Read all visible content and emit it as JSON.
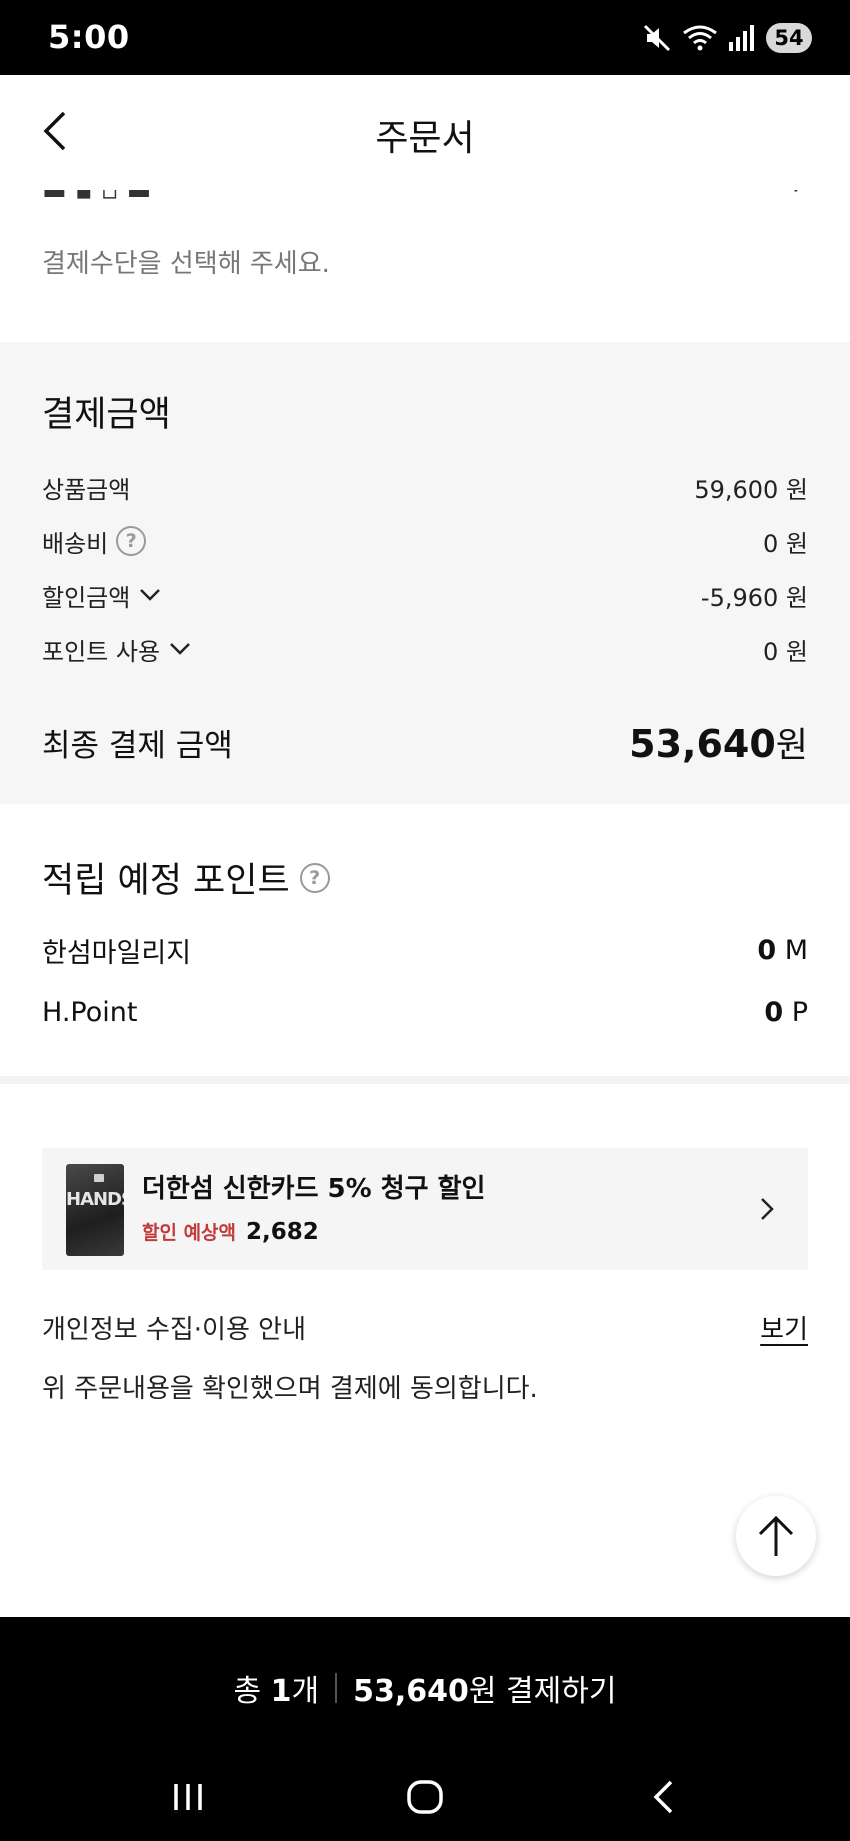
{
  "status_bar": {
    "time": "5:00",
    "battery": "54"
  },
  "header": {
    "title": "주문서"
  },
  "payment_method": {
    "hint": "결제수단을 선택해 주세요."
  },
  "payment_amount": {
    "title": "결제금액",
    "rows": [
      {
        "label": "상품금액",
        "value": "59,600 원"
      },
      {
        "label": "배송비",
        "value": "0 원"
      },
      {
        "label": "할인금액",
        "value": "-5,960 원"
      },
      {
        "label": "포인트 사용",
        "value": "0 원"
      }
    ],
    "final_label": "최종 결제 금액",
    "final_value": "53,640",
    "final_unit": "원"
  },
  "points": {
    "title": "적립 예정 포인트",
    "rows": [
      {
        "label": "한섬마일리지",
        "value": "0",
        "unit": "M"
      },
      {
        "label": "H.Point",
        "value": "0",
        "unit": "P"
      }
    ]
  },
  "card_banner": {
    "title": "더한섬 신한카드 5% 청구 할인",
    "sub_label": "할인 예상액",
    "sub_value": "2,682",
    "card_text": "HANDSOME"
  },
  "privacy": {
    "label": "개인정보 수집·이용 안내",
    "link": "보기"
  },
  "agreement": "위 주문내용을 확인했으며 결제에 동의합니다.",
  "checkout": {
    "count_prefix": "총 ",
    "count": "1",
    "count_suffix": "개",
    "amount": "53,640",
    "amount_suffix": "원 결제하기"
  },
  "icons": {
    "back": "chevron-left-icon",
    "help": "question-circle-icon",
    "expand": "chevron-down-icon",
    "arrow": "chevron-right-icon",
    "top": "arrow-up-icon"
  },
  "colors": {
    "discount_label": "#c23b3b",
    "section_bg": "#f6f6f6",
    "bottom_bar": "#000000"
  }
}
